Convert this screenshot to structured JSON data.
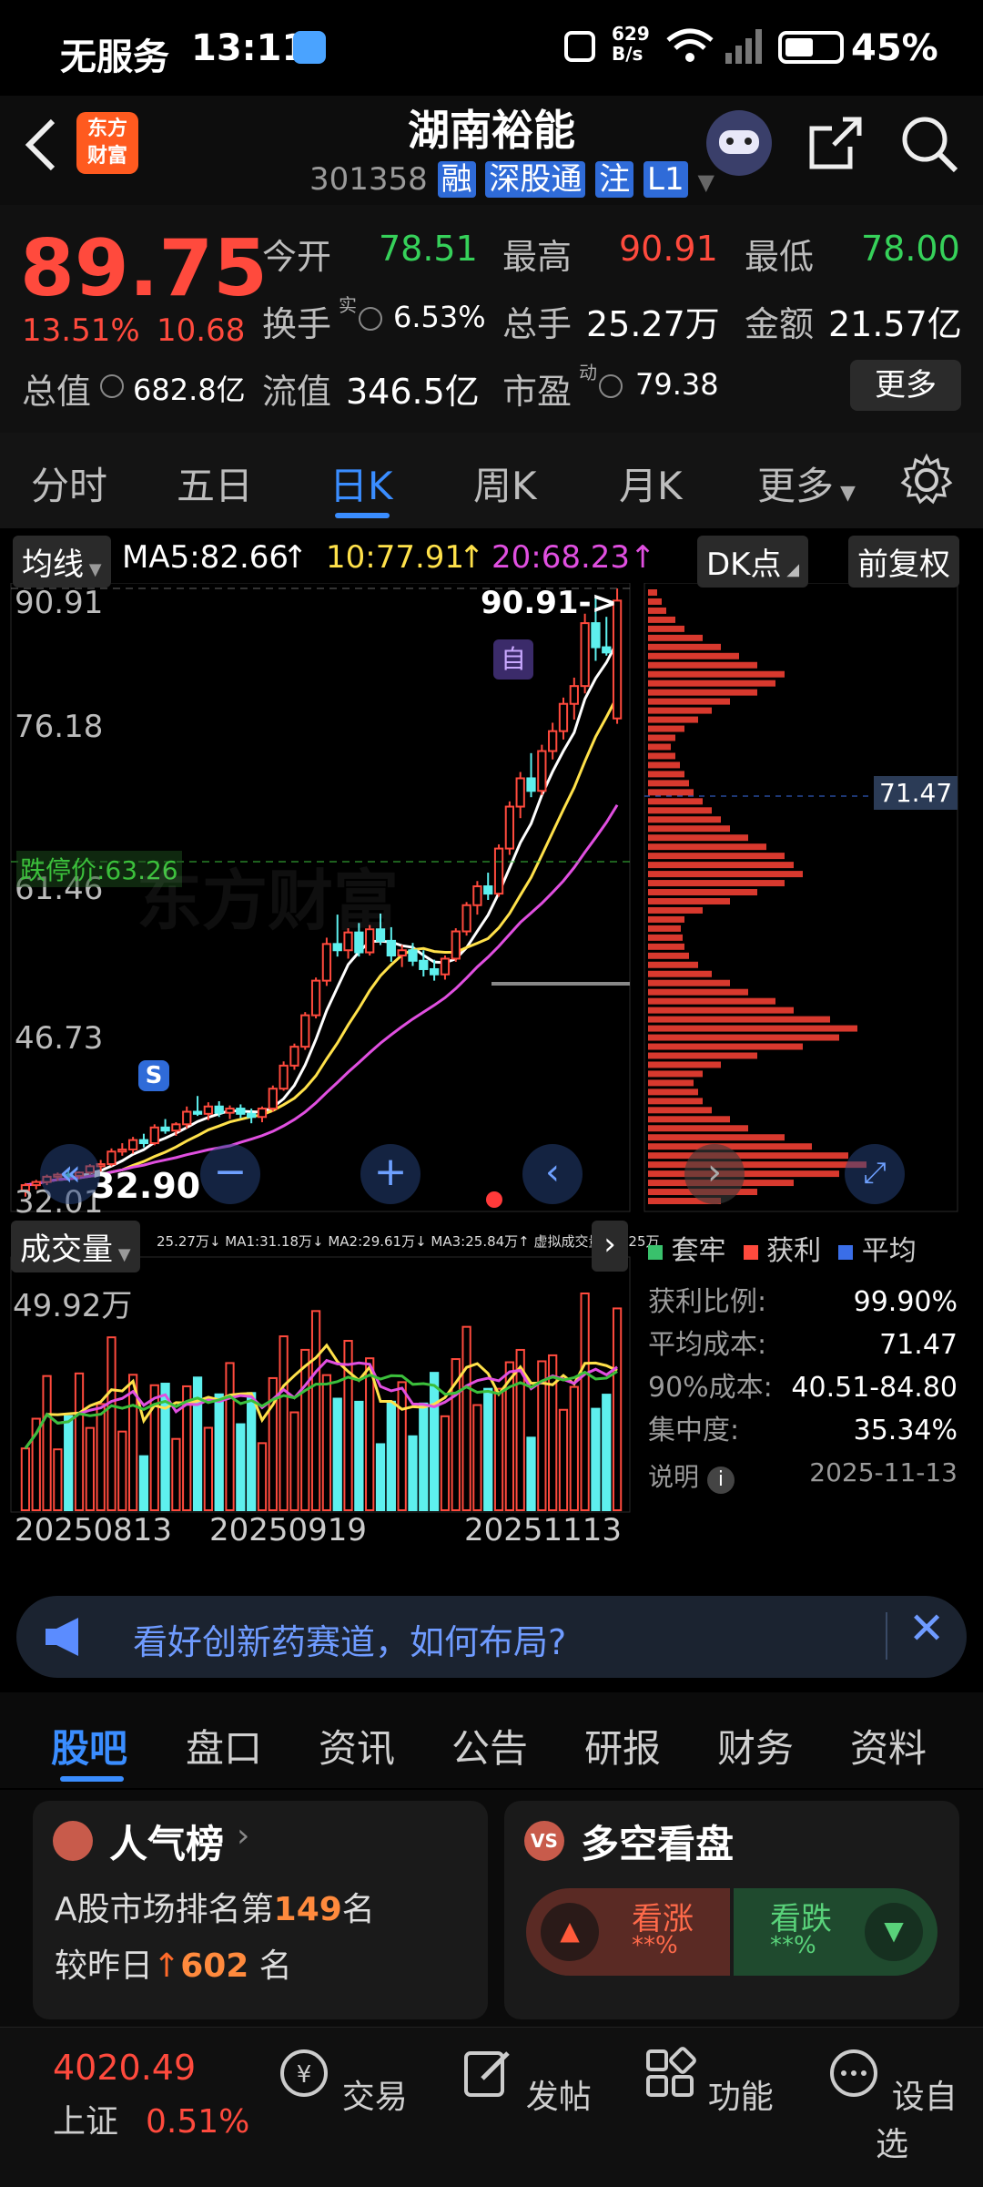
{
  "status": {
    "carrier": "无服务",
    "time": "13:11",
    "speed_top": "629",
    "speed_bottom": "B/s",
    "battery": "45%"
  },
  "header": {
    "title": "湖南裕能",
    "code": "301358",
    "badges": [
      "融",
      "深股通",
      "注",
      "L1"
    ],
    "logo_text": [
      "东方",
      "财富"
    ]
  },
  "quote": {
    "price": "89.75",
    "change_pct": "13.51%",
    "change": "10.68",
    "open_label": "今开",
    "open": "78.51",
    "high_label": "最高",
    "high": "90.91",
    "low_label": "最低",
    "low": "78.00",
    "turnover_label": "换手",
    "turnover_sup": "实",
    "turnover": "6.53%",
    "volume_label": "总手",
    "volume": "25.27万",
    "amount_label": "金额",
    "amount": "21.57亿",
    "mcap_label": "总值",
    "mcap": "682.8亿",
    "float_label": "流值",
    "float": "346.5亿",
    "pe_label": "市盈",
    "pe_sup": "动",
    "pe": "79.38",
    "more": "更多"
  },
  "tabs": [
    "分时",
    "五日",
    "日K",
    "周K",
    "月K",
    "更多"
  ],
  "chart": {
    "ma_label": "均线",
    "ma5": "MA5:82.66",
    "ma10": "10:77.91",
    "ma20": "20:68.23",
    "dk_label": "DK点",
    "fq_label": "前复权",
    "y_labels": [
      "90.91",
      "76.18",
      "61.46",
      "46.73",
      "32.01"
    ],
    "high_mark": "90.91->",
    "low_mark": "32.90",
    "limit_down": "跌停价:63.26",
    "zi": "自",
    "s_badge": "S",
    "avg_cost_tag": "71.47",
    "watermark": "东方财富",
    "vol_label": "成交量",
    "vol_legend": "25.27万↓ MA1:31.18万↓ MA2:29.61万↓ MA3:25.84万↑ 虚拟成交量:33.25万",
    "vol_max": "49.92万",
    "dates": [
      "20250813",
      "20250919",
      "20251113"
    ]
  },
  "chips": {
    "legend": [
      "套牢",
      "获利",
      "平均"
    ],
    "rows": [
      {
        "label": "获利比例:",
        "value": "99.90%"
      },
      {
        "label": "平均成本:",
        "value": "71.47"
      },
      {
        "label": "90%成本:",
        "value": "40.51-84.80"
      },
      {
        "label": "集中度:",
        "value": "35.34%"
      }
    ],
    "note_label": "说明",
    "note_date": "2025-11-13"
  },
  "chart_data": {
    "type": "candlestick",
    "ylim": [
      32.01,
      90.91
    ],
    "candles": [
      [
        33.5,
        34.2,
        32.9,
        34.0
      ],
      [
        34.0,
        34.5,
        33.6,
        34.3
      ],
      [
        34.3,
        35.0,
        34.0,
        34.8
      ],
      [
        34.8,
        35.2,
        34.4,
        35.0
      ],
      [
        35.0,
        35.6,
        34.5,
        34.9
      ],
      [
        34.9,
        35.3,
        34.6,
        35.2
      ],
      [
        35.2,
        36.0,
        35.0,
        35.8
      ],
      [
        35.8,
        36.4,
        35.3,
        36.0
      ],
      [
        36.0,
        37.5,
        35.8,
        37.2
      ],
      [
        37.2,
        38.0,
        36.8,
        37.4
      ],
      [
        37.4,
        38.6,
        37.0,
        38.3
      ],
      [
        38.3,
        38.9,
        37.6,
        38.0
      ],
      [
        38.0,
        39.8,
        37.8,
        39.5
      ],
      [
        39.5,
        40.3,
        38.9,
        39.2
      ],
      [
        39.2,
        40.0,
        38.7,
        39.8
      ],
      [
        39.8,
        41.5,
        39.4,
        41.0
      ],
      [
        41.0,
        42.5,
        40.6,
        40.8
      ],
      [
        40.8,
        41.9,
        40.2,
        41.5
      ],
      [
        41.5,
        42.0,
        40.5,
        40.9
      ],
      [
        40.9,
        41.6,
        40.3,
        41.3
      ],
      [
        41.3,
        41.7,
        40.4,
        40.8
      ],
      [
        40.8,
        41.3,
        39.9,
        40.5
      ],
      [
        40.5,
        41.5,
        40.0,
        41.3
      ],
      [
        41.3,
        43.5,
        41.0,
        43.2
      ],
      [
        43.2,
        45.8,
        43.0,
        45.4
      ],
      [
        45.4,
        47.5,
        45.0,
        47.2
      ],
      [
        47.2,
        50.5,
        46.9,
        50.2
      ],
      [
        50.2,
        53.8,
        49.9,
        53.5
      ],
      [
        53.5,
        57.6,
        53.0,
        57.0
      ],
      [
        57.0,
        59.8,
        55.8,
        56.4
      ],
      [
        56.4,
        58.5,
        55.6,
        58.1
      ],
      [
        58.1,
        59.0,
        55.8,
        56.2
      ],
      [
        56.2,
        58.8,
        55.9,
        58.4
      ],
      [
        58.4,
        59.9,
        56.9,
        57.3
      ],
      [
        57.3,
        58.6,
        55.3,
        55.9
      ],
      [
        55.9,
        56.9,
        54.8,
        56.4
      ],
      [
        56.4,
        57.1,
        54.9,
        55.4
      ],
      [
        55.4,
        56.4,
        53.9,
        54.6
      ],
      [
        54.6,
        55.5,
        53.5,
        54.1
      ],
      [
        54.1,
        55.9,
        53.6,
        55.6
      ],
      [
        55.6,
        58.5,
        55.3,
        58.2
      ],
      [
        58.2,
        61.0,
        57.8,
        60.7
      ],
      [
        60.7,
        63.0,
        59.8,
        62.5
      ],
      [
        62.5,
        63.8,
        61.2,
        61.8
      ],
      [
        61.8,
        66.5,
        61.5,
        66.1
      ],
      [
        66.1,
        70.6,
        65.5,
        70.1
      ],
      [
        70.1,
        73.4,
        69.0,
        72.8
      ],
      [
        72.8,
        75.2,
        71.0,
        71.6
      ],
      [
        71.6,
        76.0,
        71.2,
        75.4
      ],
      [
        75.4,
        78.1,
        74.6,
        77.3
      ],
      [
        77.3,
        80.5,
        76.5,
        79.9
      ],
      [
        79.9,
        82.4,
        78.4,
        81.6
      ],
      [
        81.6,
        88.5,
        80.9,
        87.6
      ],
      [
        87.6,
        90.0,
        84.0,
        85.3
      ],
      [
        85.3,
        88.2,
        84.5,
        84.8
      ],
      [
        78.51,
        90.91,
        78.0,
        89.75
      ]
    ]
  }
}
